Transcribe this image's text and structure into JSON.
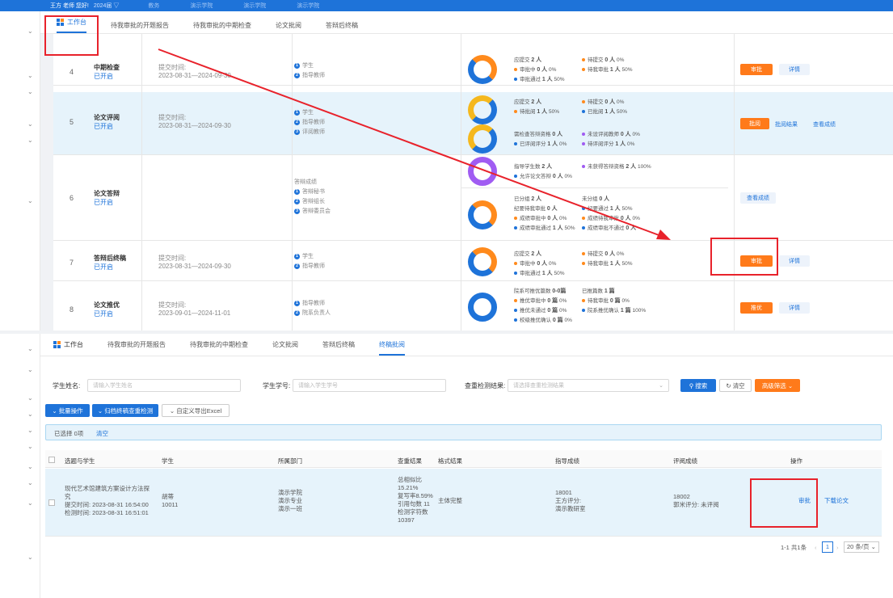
{
  "topbar": {
    "user": "王方 老师 您好!",
    "year": "2024届 ▽",
    "nav": [
      "教务",
      "演示学院",
      "演示学院",
      "演示学院"
    ]
  },
  "tabs_top": [
    "工作台",
    "待我审批的开题报告",
    "待我审批的中期检查",
    "论文批阅",
    "答辩后终稿"
  ],
  "tabs_bottom": [
    "工作台",
    "待我审批的开题报告",
    "待我审批的中期检查",
    "论文批阅",
    "答辩后终稿",
    "终稿批阅"
  ],
  "rows": [
    {
      "no": "4",
      "name": "中期检查",
      "status": "已开启",
      "time_label": "提交时间:",
      "time": "2023-08-31—2024-09-30",
      "steps": [
        "学生",
        "指导教师"
      ]
    },
    {
      "no": "5",
      "name": "论文评阅",
      "status": "已开启",
      "time_label": "提交时间:",
      "time": "2023-08-31—2024-09-30",
      "steps": [
        "学生",
        "指导教师",
        "评阅教师"
      ]
    },
    {
      "no": "6",
      "name": "论文答辩",
      "status": "已开启",
      "steps_title": "答辩成绩",
      "steps": [
        "答辩秘书",
        "答辩组长",
        "答辩委员会"
      ]
    },
    {
      "no": "7",
      "name": "答辩后终稿",
      "status": "已开启",
      "time_label": "提交时间:",
      "time": "2023-08-31—2024-09-30",
      "steps": [
        "学生",
        "指导教师"
      ]
    },
    {
      "no": "8",
      "name": "论文推优",
      "status": "已开启",
      "time_label": "提交时间:",
      "time": "2023-09-01—2024-11-01",
      "steps": [
        "指导教师",
        "院系负责人"
      ]
    }
  ],
  "stats": {
    "r4": {
      "a": "应提交",
      "a_v": "2 人",
      "b": "审批中",
      "b_v": "0 人",
      "b_p": "0%",
      "c": "审批通过",
      "c_v": "1 人",
      "c_p": "50%",
      "d": "待提交",
      "d_v": "0 人",
      "d_p": "0%",
      "e": "待我审批",
      "e_v": "1 人",
      "e_p": "50%"
    },
    "r5a": {
      "a": "应提交",
      "a_v": "2 人",
      "b": "待批阅",
      "b_v": "1 人",
      "b_p": "50%",
      "d": "待提交",
      "d_v": "0 人",
      "d_p": "0%",
      "e": "已批阅",
      "e_v": "1 人",
      "e_p": "50%"
    },
    "r5b": {
      "a": "需检查答辩资格",
      "a_v": "0 人",
      "b": "已评阅评分",
      "b_v": "1 人",
      "b_p": "0%",
      "d": "未设评阅教师",
      "d_v": "0 人",
      "d_p": "0%",
      "e": "待评阅评分",
      "e_v": "1 人",
      "e_p": "0%"
    },
    "r6a": {
      "a": "指导学生数",
      "a_v": "2 人",
      "b": "允许论文答辩",
      "b_v": "0 人",
      "b_p": "0%",
      "d": "未获得答辩资格",
      "d_v": "2 人",
      "d_p": "100%"
    },
    "r6b": {
      "a": "已分组",
      "a_v": "2 人",
      "b": "纪要待我审批",
      "b_v": "0 人",
      "c": "成绩审批中",
      "c_v": "0 人",
      "c_p": "0%",
      "f": "成绩审批通过",
      "f_v": "1 人",
      "f_p": "50%",
      "d": "未分组",
      "d_v": "0 人",
      "e": "纪要通过",
      "e_v": "1 人",
      "e_p": "50%",
      "g": "成绩待我审批",
      "g_v": "0 人",
      "g_p": "0%",
      "h": "成绩审批不通过",
      "h_v": "0 人"
    },
    "r7": {
      "a": "应提交",
      "a_v": "2 人",
      "b": "审批中",
      "b_v": "0 人",
      "b_p": "0%",
      "c": "审批通过",
      "c_v": "1 人",
      "c_p": "50%",
      "d": "待提交",
      "d_v": "0 人",
      "d_p": "0%",
      "e": "待我审批",
      "e_v": "1 人",
      "e_p": "50%"
    },
    "r8": {
      "a": "院系可推优篇数",
      "a_v": "0-0篇",
      "b": "推优审批中",
      "b_v": "0 篇",
      "b_p": "0%",
      "c": "推优未通过",
      "c_v": "0 篇",
      "c_p": "0%",
      "cc": "校级推优确认",
      "cc_v": "0 篇",
      "cc_p": "0%",
      "d": "已推篇数",
      "d_v": "1 篇",
      "e": "待我审批",
      "e_v": "0 篇",
      "e_p": "0%",
      "f": "院系推优确认",
      "f_v": "1 篇",
      "f_p": "100%"
    }
  },
  "actions": {
    "approve": "审批",
    "detail": "详情",
    "review": "批阅",
    "review_result": "批阅结果",
    "view_score": "查看成绩",
    "recommend": "推优"
  },
  "form": {
    "name_label": "学生姓名:",
    "name_ph": "请输入学生姓名",
    "id_label": "学生学号:",
    "id_ph": "请输入学生学号",
    "check_label": "查重检测结果:",
    "check_ph": "请选择查重检测结果",
    "search": "搜索",
    "clear": "清空",
    "advanced": "高级筛选"
  },
  "toolbar": {
    "batch": "批量操作",
    "archive": "归档终稿查重检测",
    "export": "自定义导出Excel",
    "selected": "已选择 0项",
    "clear": "清空"
  },
  "table": {
    "headers": [
      "选题与学生",
      "学生",
      "所属部门",
      "查重结果",
      "格式结果",
      "指导成绩",
      "评阅成绩",
      "操作"
    ],
    "row": {
      "topic": "现代艺术馆建筑方案设计方法探究",
      "submit": "提交时间: 2023-08-31 16:54:00",
      "check": "检测时间: 2023-08-31 16:51:01",
      "student": "胡蒂",
      "sid": "10011",
      "dept": [
        "演示学院",
        "演示专业",
        "演示一班"
      ],
      "dup": [
        "总相似比",
        "15.21%",
        "复写率8.59%",
        "引用句数 11",
        "检测字符数",
        "10397"
      ],
      "format": "主体完整",
      "guide": [
        "18001",
        "王方评分:",
        "演示教研室"
      ],
      "rev": [
        "18002",
        "郭米评分: 未评阅"
      ],
      "op1": "审批",
      "op2": "下载论文"
    }
  },
  "pager": {
    "total": "1-1 共1条",
    "page": "1",
    "size": "20 条/页"
  }
}
